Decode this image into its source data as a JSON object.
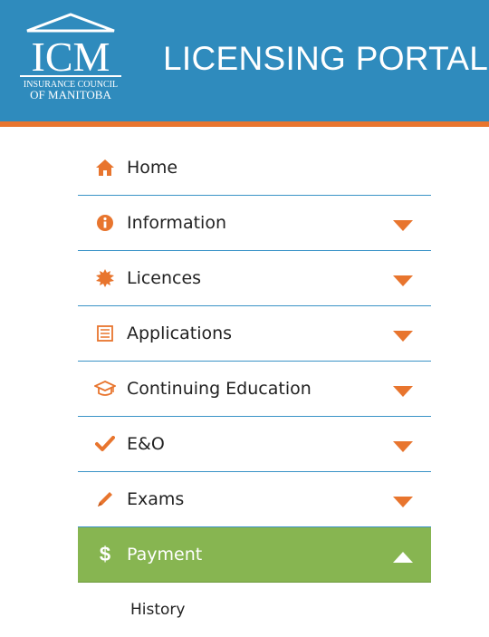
{
  "header": {
    "logo_main": "ICM",
    "logo_line1": "INSURANCE COUNCIL",
    "logo_line2": "OF MANITOBA",
    "title": "LICENSING PORTAL"
  },
  "nav": {
    "items": [
      {
        "label": "Home",
        "icon": "home-icon"
      },
      {
        "label": "Information",
        "icon": "info-icon"
      },
      {
        "label": "Licences",
        "icon": "seal-icon"
      },
      {
        "label": "Applications",
        "icon": "form-icon"
      },
      {
        "label": "Continuing Education",
        "icon": "graduation-cap-icon"
      },
      {
        "label": "E&O",
        "icon": "checkmark-icon"
      },
      {
        "label": "Exams",
        "icon": "pencil-icon"
      },
      {
        "label": "Payment",
        "icon": "dollar-icon"
      }
    ],
    "payment_sub": {
      "label": "History"
    }
  },
  "colors": {
    "header_bg": "#2f8bbd",
    "accent_orange": "#e8752e",
    "active_green": "#87b551",
    "divider_blue": "#3a93c7"
  }
}
